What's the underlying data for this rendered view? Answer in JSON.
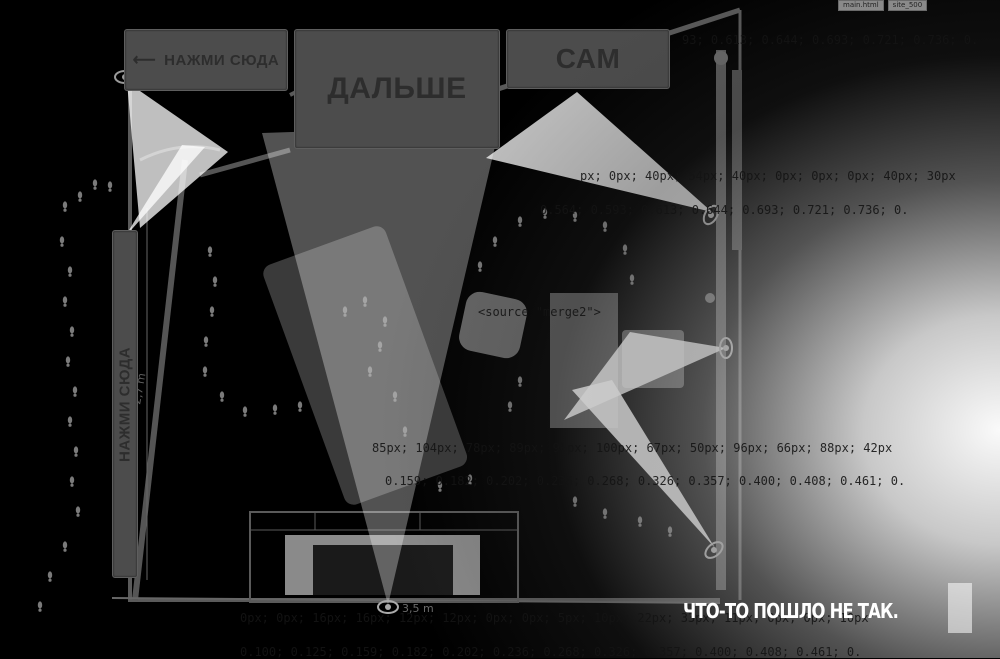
{
  "buttons": {
    "press_here_top": "НАЖМИ СЮДА",
    "next": "ДАЛЬШЕ",
    "self": "САМ",
    "press_here_side": "НАЖМИ СЮДА"
  },
  "dimensions": {
    "left_wall": "2,7 m",
    "bottom_wall": "3,5 m"
  },
  "error_message": "ЧТО-ТО ПОШЛО НЕ ТАК.",
  "background_code": {
    "line1": "93; 0.613; 0.644; 0.693; 0.721; 0.736; 0.",
    "line2": "px; 0px; 40px; 54px; 40px; 0px; 0px; 0px; 40px; 30px",
    "line3": "0.564; 0.593; 0.613; 0.644; 0.693; 0.721; 0.736; 0.",
    "line4": "<source \"merge2\">",
    "line5": "85px; 104px; 78px; 89px; 96px; 100px; 67px; 50px; 96px; 66px; 88px; 42px",
    "line6": "0.159; 0.182; 0.202; 0.236; 0.268; 0.326; 0.357; 0.400; 0.408; 0.461; 0.",
    "line7": "0px; 0px; 16px; 16px; 12px; 12px; 0px; 0px; 5px; 10px; 22px; 33px; 11px; 0px; 0px; 10px'",
    "line8": "0.100; 0.125; 0.159; 0.182; 0.202; 0.236; 0.268; 0.326; 0.357; 0.400; 0.408; 0.461; 0."
  },
  "browser_tabs": [
    "main.html",
    "site_500"
  ],
  "icons": [
    "eye-icon",
    "arrow-left-icon",
    "footprint-icon"
  ],
  "colors": {
    "background": "#000000",
    "button_fill": "#4c4c4c",
    "button_text": "#2d2d2d",
    "beam": "#ffffff",
    "error_text": "#ffffff"
  }
}
